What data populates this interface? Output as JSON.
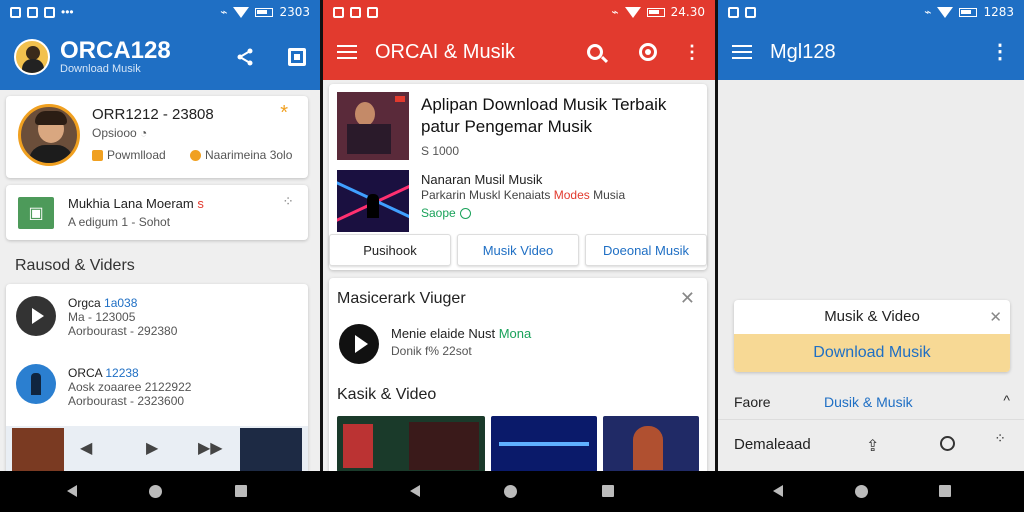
{
  "colors": {
    "blue": "#1f6fc4",
    "red": "#e23a2e",
    "accent_green": "#1aa25a",
    "orange": "#f0a020",
    "yellow_bar": "#f7d995",
    "link_blue": "#1f6fc4"
  },
  "left": {
    "status_time": "2303",
    "app_title": "ORCA128",
    "app_subtitle": "Download Musik",
    "profile": {
      "name": "ORR1212 - 23808",
      "sub": "Opsiooo",
      "download_label": "Powmlload",
      "more_label": "Naarimeina 3olo"
    },
    "mini_card": {
      "title": "Mukhia Lana Moeram",
      "title_suffix": "s",
      "subtitle": "A edigum 1 - Sohot"
    },
    "section_title": "Rausod & Viders",
    "list": [
      {
        "title": "Orgca",
        "title_accent": "1a038",
        "line2": "Ma - 123005",
        "line3": "Aorbourast - 292380"
      },
      {
        "title": "ORCA",
        "title_accent": "12238",
        "line2": "Aosk zoaaree 2122922",
        "line3": "Aorbourast - 2323600"
      }
    ]
  },
  "middle": {
    "status_time": "24.30",
    "app_title": "ORCAI & Musik",
    "featured": {
      "title_line1": "Aplipan Download Musik Terbaik",
      "title_line2": "patur Pengemar Musik",
      "meta": "S 1000"
    },
    "item2": {
      "title": "Nanaran Musil Musik",
      "desc_prefix": "Parkarin Muskl Kenaiats",
      "desc_accent": "Modes",
      "desc_suffix": "Musia",
      "status": "Saope"
    },
    "buttons": [
      "Pusihook",
      "Musik Video",
      "Doeonal Musik"
    ],
    "panel_title": "Masicerark Viuger",
    "player": {
      "title": "Menie elaide Nust",
      "title_accent": "Mona",
      "sub": "Donik f% 22sot"
    },
    "gallery_title": "Kasik & Video"
  },
  "right": {
    "status_time": "1283",
    "app_title": "Mgl128",
    "dialog": {
      "title": "Musik & Video",
      "button": "Download Musik"
    },
    "row1": {
      "label": "Faore",
      "value": "Dusik & Musik"
    },
    "row2": {
      "label": "Demaleaad"
    }
  }
}
